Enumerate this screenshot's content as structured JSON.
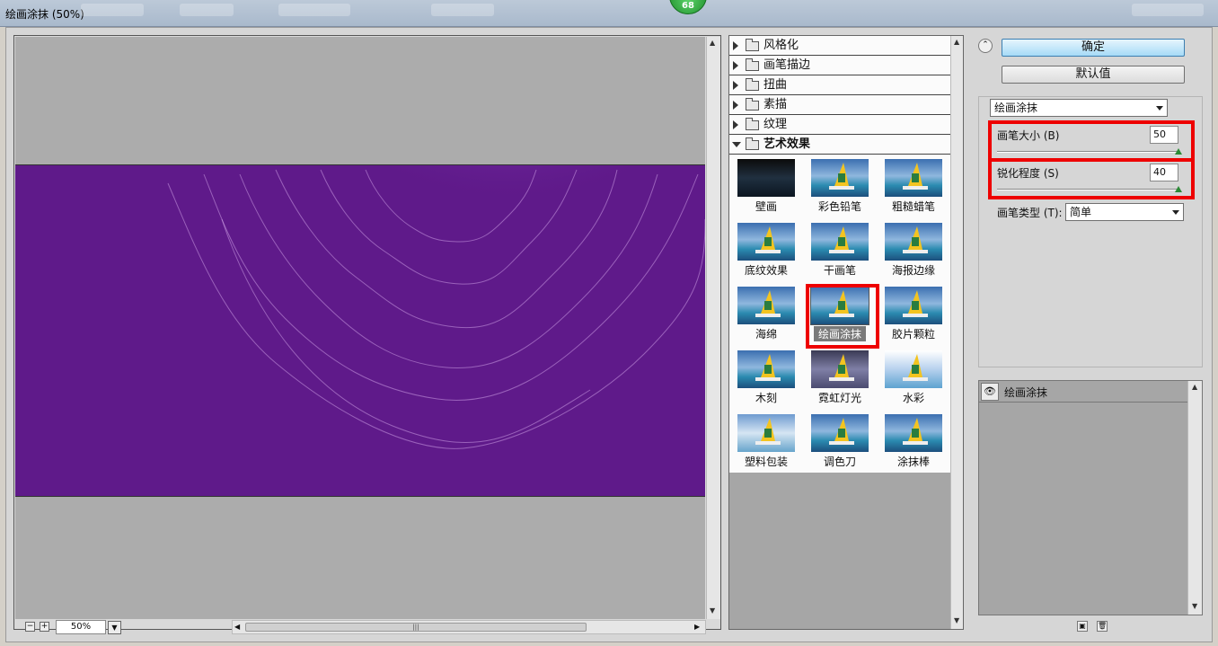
{
  "window": {
    "title": "绘画涂抹 (50%)",
    "badge": "68"
  },
  "preview": {
    "zoom": "50%",
    "zoom_out_symbol": "−",
    "zoom_in_symbol": "+",
    "image_colors": {
      "background": "#5f1a8a",
      "highlight": "#c47cf0"
    }
  },
  "filters": {
    "categories": [
      {
        "label": "风格化",
        "expanded": false
      },
      {
        "label": "画笔描边",
        "expanded": false
      },
      {
        "label": "扭曲",
        "expanded": false
      },
      {
        "label": "素描",
        "expanded": false
      },
      {
        "label": "纹理",
        "expanded": false
      },
      {
        "label": "艺术效果",
        "expanded": true
      }
    ],
    "thumbnails": [
      {
        "label": "壁画",
        "style": "dark"
      },
      {
        "label": "彩色铅笔",
        "style": "normal"
      },
      {
        "label": "粗糙蜡笔",
        "style": "normal"
      },
      {
        "label": "底纹效果",
        "style": "normal"
      },
      {
        "label": "干画笔",
        "style": "normal"
      },
      {
        "label": "海报边缘",
        "style": "normal"
      },
      {
        "label": "海绵",
        "style": "normal"
      },
      {
        "label": "绘画涂抹",
        "style": "normal",
        "selected": true
      },
      {
        "label": "胶片颗粒",
        "style": "normal"
      },
      {
        "label": "木刻",
        "style": "normal"
      },
      {
        "label": "霓虹灯光",
        "style": "neon"
      },
      {
        "label": "水彩",
        "style": "water"
      },
      {
        "label": "塑料包装",
        "style": "plastic"
      },
      {
        "label": "调色刀",
        "style": "normal"
      },
      {
        "label": "涂抹棒",
        "style": "normal"
      }
    ]
  },
  "settings": {
    "ok_label": "确定",
    "default_label": "默认值",
    "filter_select": "绘画涂抹",
    "brush_size": {
      "label": "画笔大小 (B)",
      "value": "50",
      "fraction": 1.0
    },
    "sharpness": {
      "label": "锐化程度 (S)",
      "value": "40",
      "fraction": 1.0
    },
    "brush_type": {
      "label": "画笔类型 (T):",
      "value": "简单"
    }
  },
  "layers": {
    "items": [
      "绘画涂抹"
    ]
  },
  "colors": {
    "highlight_red": "#e00000",
    "primary_button": "#a6dbf7",
    "selected_thumb": "#7a7a7a"
  }
}
